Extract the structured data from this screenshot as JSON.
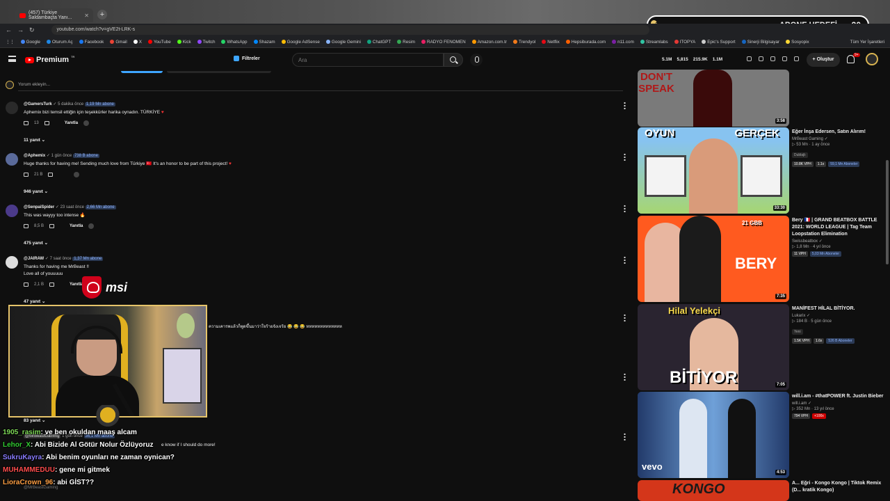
{
  "browser": {
    "tab_title": "(457) Türkiye Saldambaçta Yanı...",
    "url": "youtube.com/watch?v=gVE2t-LRK-s",
    "bookmarks": [
      {
        "label": "Google",
        "color": "#4285f4"
      },
      {
        "label": "Oturum Aç",
        "color": "#1e88e5"
      },
      {
        "label": "Facebook",
        "color": "#1877f2"
      },
      {
        "label": "Gmail",
        "color": "#ea4335"
      },
      {
        "label": "X",
        "color": "#ffffff"
      },
      {
        "label": "YouTube",
        "color": "#ff0000"
      },
      {
        "label": "Kick",
        "color": "#53fc18"
      },
      {
        "label": "Twitch",
        "color": "#9146ff"
      },
      {
        "label": "WhatsApp",
        "color": "#25d366"
      },
      {
        "label": "Shazam",
        "color": "#0088ff"
      },
      {
        "label": "Google AdSense",
        "color": "#fbbc05"
      },
      {
        "label": "Google Gemini",
        "color": "#8ab4f8"
      },
      {
        "label": "ChatGPT",
        "color": "#10a37f"
      },
      {
        "label": "Resim",
        "color": "#34a853"
      },
      {
        "label": "RADYO FENOMEN",
        "color": "#e91e63"
      },
      {
        "label": "Amazon.com.tr",
        "color": "#ff9900"
      },
      {
        "label": "Trendyol",
        "color": "#f27a1a"
      },
      {
        "label": "Netflix",
        "color": "#e50914"
      },
      {
        "label": "Hepsiburada.com",
        "color": "#ff6000"
      },
      {
        "label": "n11.com",
        "color": "#7b1fa2"
      },
      {
        "label": "Streamlabs",
        "color": "#31c3a2"
      },
      {
        "label": "ITOPYA",
        "color": "#e53935"
      },
      {
        "label": "Epic's Support",
        "color": "#cccccc"
      },
      {
        "label": "Sinerji Bilgisayar",
        "color": "#1565c0"
      },
      {
        "label": "Sosyopix",
        "color": "#fdd835"
      }
    ],
    "bookmarks_all": "Tüm Yer İşaretleri"
  },
  "goal": {
    "start": "1",
    "label": "ABONE HEDEFİ",
    "target": "30",
    "progress": 0.03
  },
  "header": {
    "logo": "Premium",
    "logo_region": "TR",
    "filters": "Filtreler",
    "search_placeholder": "Ara",
    "stats": [
      "5.1M",
      "5,815",
      "215.9K",
      "1.1M"
    ],
    "create": "Oluştur",
    "notifications": "9+"
  },
  "comments_section": {
    "add_comment": "Yorum ekleyin..."
  },
  "comments": [
    {
      "author": "@GamersTurk",
      "time": "5 dakika önce",
      "subs": "1,19 Mn abone",
      "text": "Aphemix bizi temsil ettiğin için teşekkürler harika oynadın. TÜRKİYE",
      "likes": "13",
      "reply": "Yanıtla",
      "replies": "11 yanıt",
      "avatar_color": "#2a2a2a"
    },
    {
      "author": "@Aphemix",
      "time": "1 gün önce",
      "subs": "738 B abone",
      "text": "Huge thanks for having me! Sending much love from Türkiye 🇹🇷 It's an honor to be part of this project!",
      "likes": "21 B",
      "reply": "",
      "replies": "946 yanıt",
      "avatar_color": "#5a6a9a"
    },
    {
      "author": "@SenpaiSpider",
      "time": "23 saat önce",
      "subs": "2,66 Mn abone",
      "text": "This was wayyy too intense 🔥",
      "likes": "8,5 B",
      "reply": "Yanıtla",
      "replies": "475 yanıt",
      "avatar_color": "#4b3a8a"
    },
    {
      "author": "@JAIRAW",
      "time": "7 saat önce",
      "subs": "1,37 Mn abone",
      "text": "Thanks for having me MrBeast !!\nLove all of youuuuu",
      "likes": "2,1 B",
      "reply": "Yanıtla",
      "replies": "47 yanıt",
      "avatar_color": "#dddddd"
    }
  ],
  "thai_comment": "ความเคารพแล้วก็พูดขึ้นมาว่าใจร้ายจังเจร้ย 😂 😂 😂 หหหหหหหหหหหหห",
  "hidden_comment": {
    "replies": "83 yanıt",
    "author": "@MrBeastGaming",
    "time": "1 gün önce",
    "subs": "36,1 Mn abone",
    "text_tail": "e know if I should do more!"
  },
  "bottom_comment_author": "@MrBeastGaming",
  "sponsor": "msi",
  "chat": [
    {
      "user": "1905_rasim",
      "msg": ": ve ben okuldan maaş alcam",
      "color": "#7ed957"
    },
    {
      "user": "Lehor_X",
      "msg": ": Abi Bizide Al Götür Nolur Özlüyoruz",
      "color": "#32cd32"
    },
    {
      "user": "SukruKayra",
      "msg": ": Abi benim oyunları ne zaman oynican?",
      "color": "#8a7cff"
    },
    {
      "user": "MUHAMMEDUU",
      "msg": ": gene mi gitmek",
      "color": "#ff4d4d"
    },
    {
      "user": "LioraCrown_96",
      "msg": ": abi GİST??",
      "color": "#ff9f43"
    }
  ],
  "sidebar": [
    {
      "thumb_text": "DON'T SPEAK",
      "duration": "3:58",
      "title": "",
      "channel": "",
      "meta": "",
      "bg": "#7a7a7a"
    },
    {
      "thumb_text": "OYUN GERÇEK",
      "duration": "33:30",
      "title": "Eğer İnşa Edersen, Satın Alırım!",
      "channel": "MrBeast Gaming",
      "meta": "▷ 53 Mn · 1 ay önce",
      "tag": "Dublajlı",
      "badges": [
        "10.8K VPH",
        "1.1x",
        "59,1 Mn Aboneler"
      ],
      "bg": "#87c3f0"
    },
    {
      "thumb_text": "BERY",
      "duration": "7:35",
      "title": "Bery 🇫🇷 | GRAND BEATBOX BATTLE 2021: WORLD LEAGUE | Tag Team Loopstation Elimination",
      "channel": "Swissbeatbox",
      "meta": "▷ 1,8 Mn · 4 yıl önce",
      "badges": [
        "11 VPH",
        "",
        "5,03 Mn Aboneler"
      ],
      "bg": "#ff5a1f",
      "thumb_sub": "21 GBB"
    },
    {
      "thumb_text": "BİTİYOR",
      "duration": "7:05",
      "title": "MANİFEST HİLAL BİTİYOR.",
      "channel": "Lukarix",
      "meta": "▷ 184 B · 5 gün önce",
      "tag": "Yeni",
      "badges": [
        "1.5K VPH",
        "1.6x",
        "526 B Aboneler"
      ],
      "bg": "#2a2430",
      "thumb_sub": "Hilal Yelekçi"
    },
    {
      "thumb_text": "vevo",
      "duration": "4:53",
      "title": "will.i.am - #thatPOWER ft. Justin Bieber",
      "channel": "will.i.am",
      "meta": "▷ 352 Mn · 13 yıl önce",
      "badges": [
        "794 VPH",
        "+100x",
        ""
      ],
      "bg": "#3a5f9a"
    },
    {
      "thumb_text": "KONGO",
      "duration": "",
      "title": "A... Eğri - Kongo Kongo | Tiktok Remix (D... kratik Kongo)",
      "channel": "",
      "meta": "",
      "bg": "#d4361a"
    }
  ]
}
